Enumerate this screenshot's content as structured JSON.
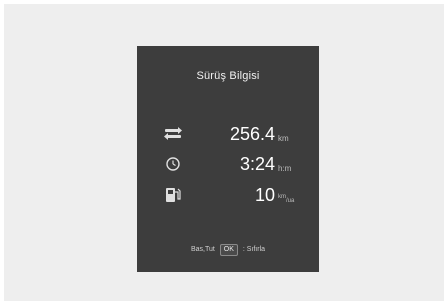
{
  "panel": {
    "title": "Sürüş Bilgisi",
    "rows": [
      {
        "icon": "trip-distance-icon",
        "value": "256.4",
        "unit": "km"
      },
      {
        "icon": "clock-icon",
        "value": "3:24",
        "unit": "h:m"
      },
      {
        "icon": "fuel-pump-icon",
        "value": "10",
        "unit_top": "km",
        "unit_bottom": "/ua"
      }
    ],
    "hint": {
      "prefix": "Bas,Tut",
      "button": "OK",
      "suffix": ": Sıfırla"
    }
  },
  "colors": {
    "screen": "#3d3d3d",
    "text": "#ffffff",
    "unit": "#bdbdbd",
    "background": "#eeeeee"
  }
}
